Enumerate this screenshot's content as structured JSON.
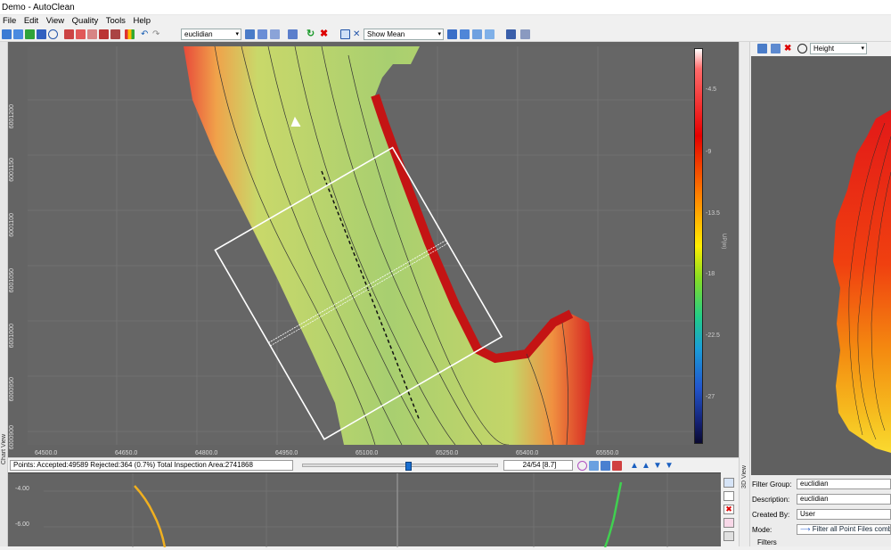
{
  "window": {
    "title": "Demo - AutoClean"
  },
  "menu": [
    "File",
    "Edit",
    "View",
    "Quality",
    "Tools",
    "Help"
  ],
  "toolbar": {
    "algorithm_select": "euclidian",
    "surface_select": "Show Mean",
    "right_select": "Height"
  },
  "map": {
    "y_ticks": [
      "6001200",
      "6001150",
      "6001100",
      "6001050",
      "6001000",
      "6000950",
      "6000900"
    ],
    "x_ticks": [
      "64500.0",
      "64650.0",
      "64800.0",
      "64950.0",
      "65100.0",
      "65250.0",
      "65400.0",
      "65550.0"
    ],
    "colorbar_ticks": [
      "-4.5",
      "-9",
      "-13.5",
      "-18",
      "-22.5",
      "-27"
    ],
    "colorbar_label": "UP(m)",
    "panel_label": "Chart View"
  },
  "right_panel": {
    "label": "3D View"
  },
  "status": {
    "points_text": "Points: Accepted:49589 Rejected:364 (0.7%) Total Inspection Area:2741868",
    "page_counter": "24/54 [8.7]"
  },
  "profile": {
    "y_ticks": [
      "-4.00",
      "-6.00"
    ]
  },
  "properties": {
    "filter_group_label": "Filter Group:",
    "filter_group_value": "euclidian",
    "description_label": "Description:",
    "description_value": "euclidian",
    "created_by_label": "Created By:",
    "created_by_value": "User",
    "mode_label": "Mode:",
    "mode_value": "Filter all Point Files combined",
    "filters_label": "Filters"
  }
}
